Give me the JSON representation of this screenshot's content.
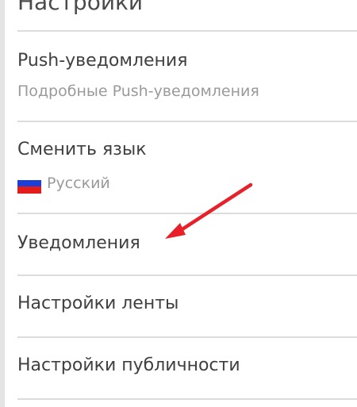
{
  "header": {
    "title": "Настройки"
  },
  "settings": {
    "push": {
      "title": "Push-уведомления",
      "subtitle": "Подробные Push-уведомления"
    },
    "language": {
      "title": "Сменить язык",
      "current": "Русский",
      "flag_icon": "russia-flag-icon",
      "flag_colors": [
        "#ffffff",
        "#1c3fd8",
        "#e21b1b"
      ]
    },
    "notifications": {
      "title": "Уведомления"
    },
    "feed": {
      "title": "Настройки ленты"
    },
    "publicity": {
      "title": "Настройки публичности"
    }
  },
  "annotation": {
    "arrow_icon": "red-arrow-icon",
    "arrow_color": "#e8202a"
  }
}
